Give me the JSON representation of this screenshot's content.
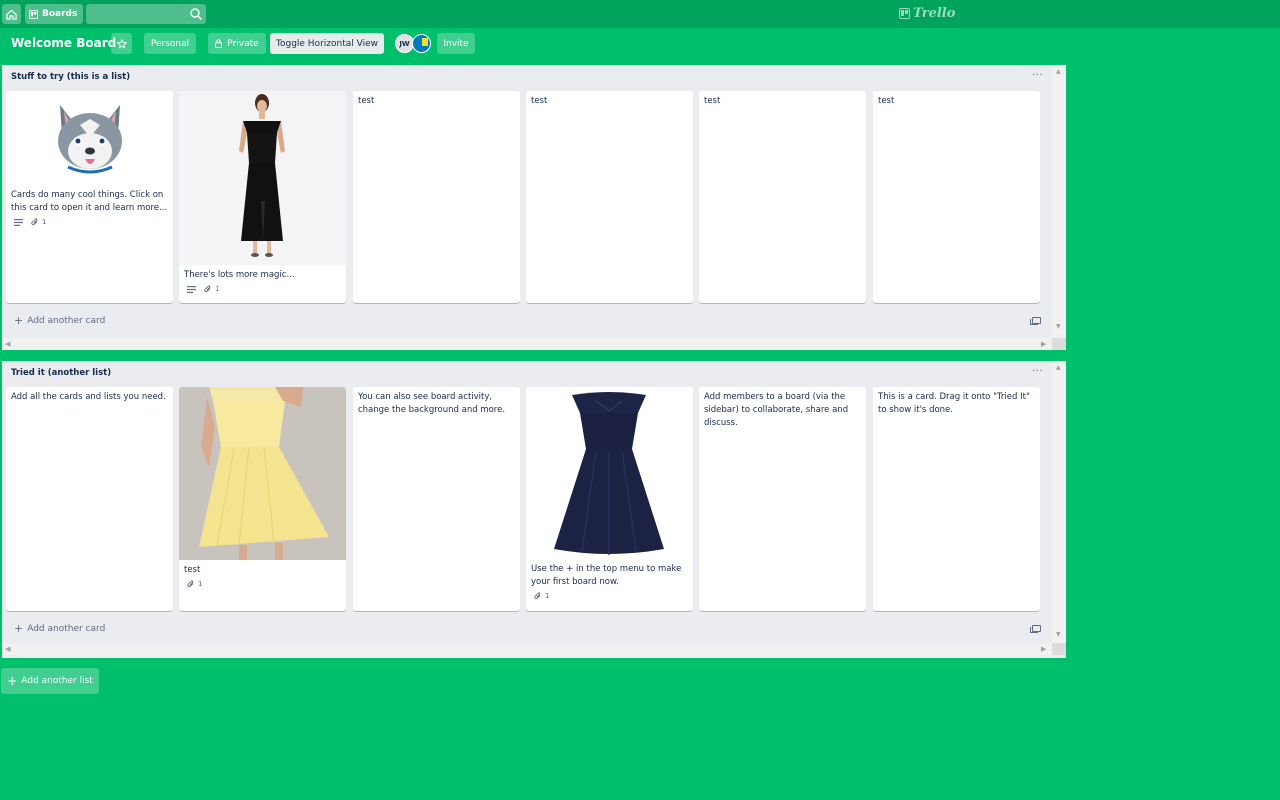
{
  "nav": {
    "boards_label": "Boards",
    "logo_text": "Trello"
  },
  "board": {
    "title": "Welcome Board",
    "personal_label": "Personal",
    "private_label": "Private",
    "toggle_label": "Toggle Horizontal View",
    "invite_label": "Invite",
    "members": [
      "JW"
    ]
  },
  "lists": [
    {
      "title": "Stuff to try (this is a list)",
      "add_card_label": "Add another card",
      "cards": [
        {
          "text": "Cards do many cool things. Click on this card to open it and learn more...",
          "attachments": "1"
        },
        {
          "text": "There's lots more magic...",
          "attachments": "1"
        },
        {
          "text": "test"
        },
        {
          "text": "test"
        },
        {
          "text": "test"
        },
        {
          "text": "test"
        }
      ]
    },
    {
      "title": "Tried it (another list)",
      "add_card_label": "Add another card",
      "cards": [
        {
          "text": "Add all the cards and lists you need."
        },
        {
          "text": "test",
          "attachments": "1"
        },
        {
          "text": "You can also see board activity, change the background and more."
        },
        {
          "text": "Use the + in the top menu to make your first board now.",
          "attachments": "1"
        },
        {
          "text": "Add members to a board (via the sidebar) to collaborate, share and discuss."
        },
        {
          "text": "This is a card. Drag it onto \"Tried It\" to show it's done."
        }
      ]
    }
  ],
  "add_list_label": "Add another list"
}
